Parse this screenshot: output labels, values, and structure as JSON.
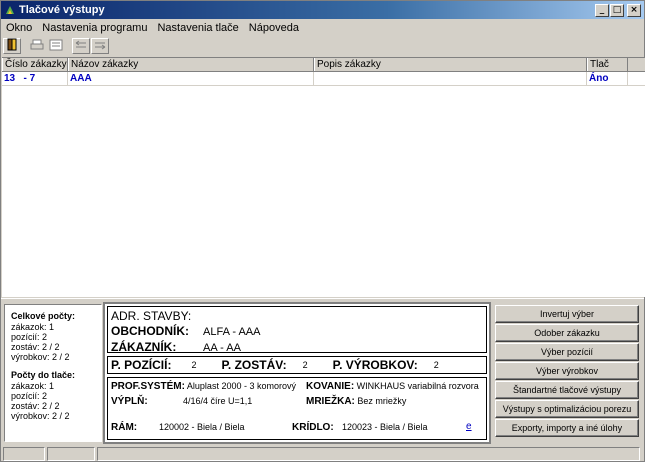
{
  "window": {
    "title": "Tlačové výstupy"
  },
  "titlebar_buttons": {
    "minimize": "_",
    "maximize": "□",
    "close": "×"
  },
  "menu": [
    "Okno",
    "Nastavenia programu",
    "Nastavenia tlače",
    "Nápoveda"
  ],
  "toolbar": {
    "tools": [
      "exit-icon",
      "print-icon",
      "print-preview-icon",
      "move-left-icon",
      "move-right-icon"
    ]
  },
  "table": {
    "columns": [
      "Číslo zákazky",
      "Názov zákazky",
      "Popis zákazky",
      "Tlač"
    ],
    "rows": [
      {
        "number": "13   - 7",
        "name": "AAA",
        "description": "",
        "print": "Áno"
      }
    ]
  },
  "counts": {
    "total_title": "Celkové počty:",
    "total": [
      "zákazok: 1",
      "pozícií: 2",
      "zostáv: 2 / 2",
      "výrobkov: 2 / 2"
    ],
    "print_title": "Počty do tlače:",
    "print": [
      "zákazok: 1",
      "pozícií: 2",
      "zostáv: 2 / 2",
      "výrobkov: 2 / 2"
    ]
  },
  "detail": {
    "adr_label": "ADR. STAVBY:",
    "adr_value": "",
    "dealer_label": "OBCHODNÍK:",
    "dealer_value": "ALFA - AAA",
    "customer_label": "ZÁKAZNÍK:",
    "customer_value": "AA - AA",
    "positions_label": "P. POZÍCIÍ:",
    "positions_value": "2",
    "sets_label": "P. ZOSTÁV:",
    "sets_value": "2",
    "products_label": "P. VÝROBKOV:",
    "products_value": "2",
    "profile_label": "PROF.SYSTÉM:",
    "profile_value": "Aluplast 2000 - 3 komorový",
    "hardware_label": "KOVANIE:",
    "hardware_value": "WINKHAUS variabilná rozvora",
    "fill_label": "VÝPLŇ:",
    "fill_value": "4/16/4 číre U=1,1",
    "mesh_label": "MRIEŽKA:",
    "mesh_value": "Bez mriežky",
    "frame_label": "RÁM:",
    "frame_value": "120002 - Biela / Biela",
    "sash_label": "KRÍDLO:",
    "sash_value": "120023 - Biela / Biela",
    "link": "e"
  },
  "buttons": [
    "Invertuj výber",
    "Odober zákazku",
    "Výber pozícií",
    "Výber výrobkov",
    "Štandartné tlačové výstupy",
    "Výstupy s optimalizáciou porezu",
    "Exporty, importy a iné úlohy"
  ],
  "colors": {
    "title_bg": "#0a246a",
    "link_blue": "#0000c0",
    "face": "#d4d0c8"
  }
}
